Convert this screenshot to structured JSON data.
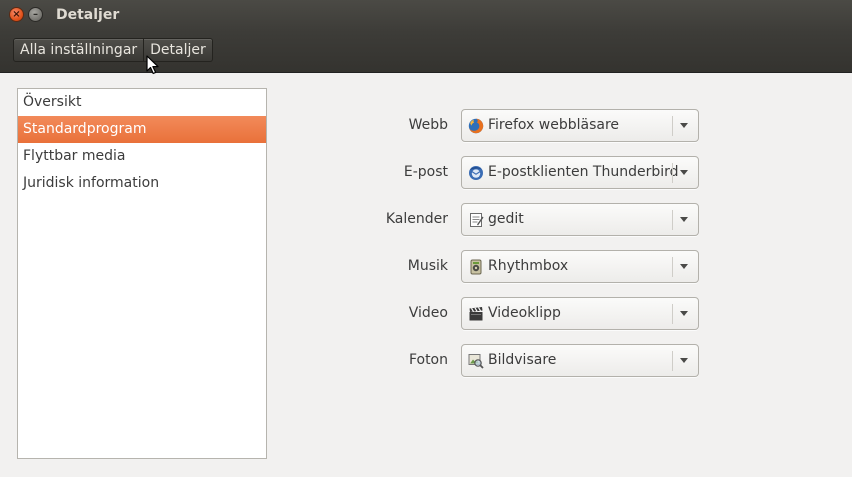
{
  "window": {
    "title": "Detaljer"
  },
  "titlebar_buttons": {
    "close_glyph": "×",
    "minimize_glyph": "–"
  },
  "toolbar": {
    "breadcrumbs": [
      {
        "label": "Alla inställningar"
      },
      {
        "label": "Detaljer"
      }
    ]
  },
  "sidebar": {
    "items": [
      {
        "label": "Översikt",
        "selected": false
      },
      {
        "label": "Standardprogram",
        "selected": true
      },
      {
        "label": "Flyttbar media",
        "selected": false
      },
      {
        "label": "Juridisk information",
        "selected": false
      }
    ]
  },
  "defaults": {
    "rows": [
      {
        "label": "Webb",
        "value": "Firefox webbläsare",
        "icon": "firefox-icon"
      },
      {
        "label": "E-post",
        "value": "E-postklienten Thunderbird",
        "icon": "thunderbird-icon"
      },
      {
        "label": "Kalender",
        "value": "gedit",
        "icon": "gedit-icon"
      },
      {
        "label": "Musik",
        "value": "Rhythmbox",
        "icon": "rhythmbox-icon"
      },
      {
        "label": "Video",
        "value": "Videoklipp",
        "icon": "videos-icon"
      },
      {
        "label": "Foton",
        "value": "Bildvisare",
        "icon": "image-viewer-icon"
      }
    ]
  },
  "colors": {
    "accent": "#e9713a",
    "header": "#3d3c38",
    "background": "#f2f1f0"
  }
}
